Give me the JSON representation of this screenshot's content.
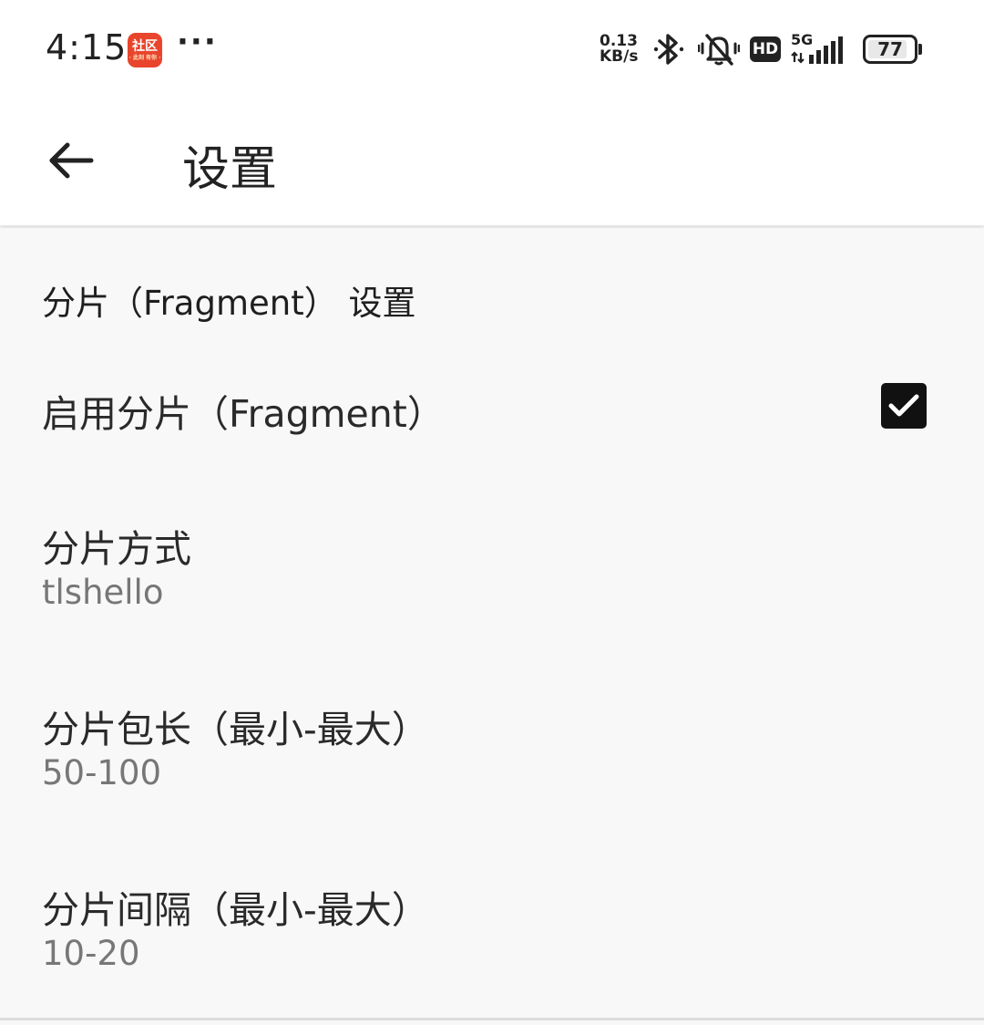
{
  "status_bar": {
    "time": "4:15",
    "app_badge_text": "社区",
    "app_badge_sub": "· 此刻 有你 ·",
    "more_indicator": "···",
    "net_speed_value": "0.13",
    "net_speed_unit": "KB/s",
    "hd_label": "HD",
    "network_type": "5G",
    "battery_level": "77"
  },
  "app_bar": {
    "title": "设置"
  },
  "settings": {
    "section_title": "分片（Fragment） 设置",
    "enable_fragment": {
      "title": "启用分片（Fragment）",
      "checked": true
    },
    "fragment_method": {
      "title": "分片方式",
      "value": "tlshello"
    },
    "fragment_length": {
      "title": "分片包长（最小-最大）",
      "value": "50-100"
    },
    "fragment_interval": {
      "title": "分片间隔（最小-最大）",
      "value": "10-20"
    }
  },
  "colors": {
    "app_badge": "#e8452c",
    "checkbox": "#111111",
    "background": "#f8f8f8",
    "summary_text": "#777777"
  }
}
